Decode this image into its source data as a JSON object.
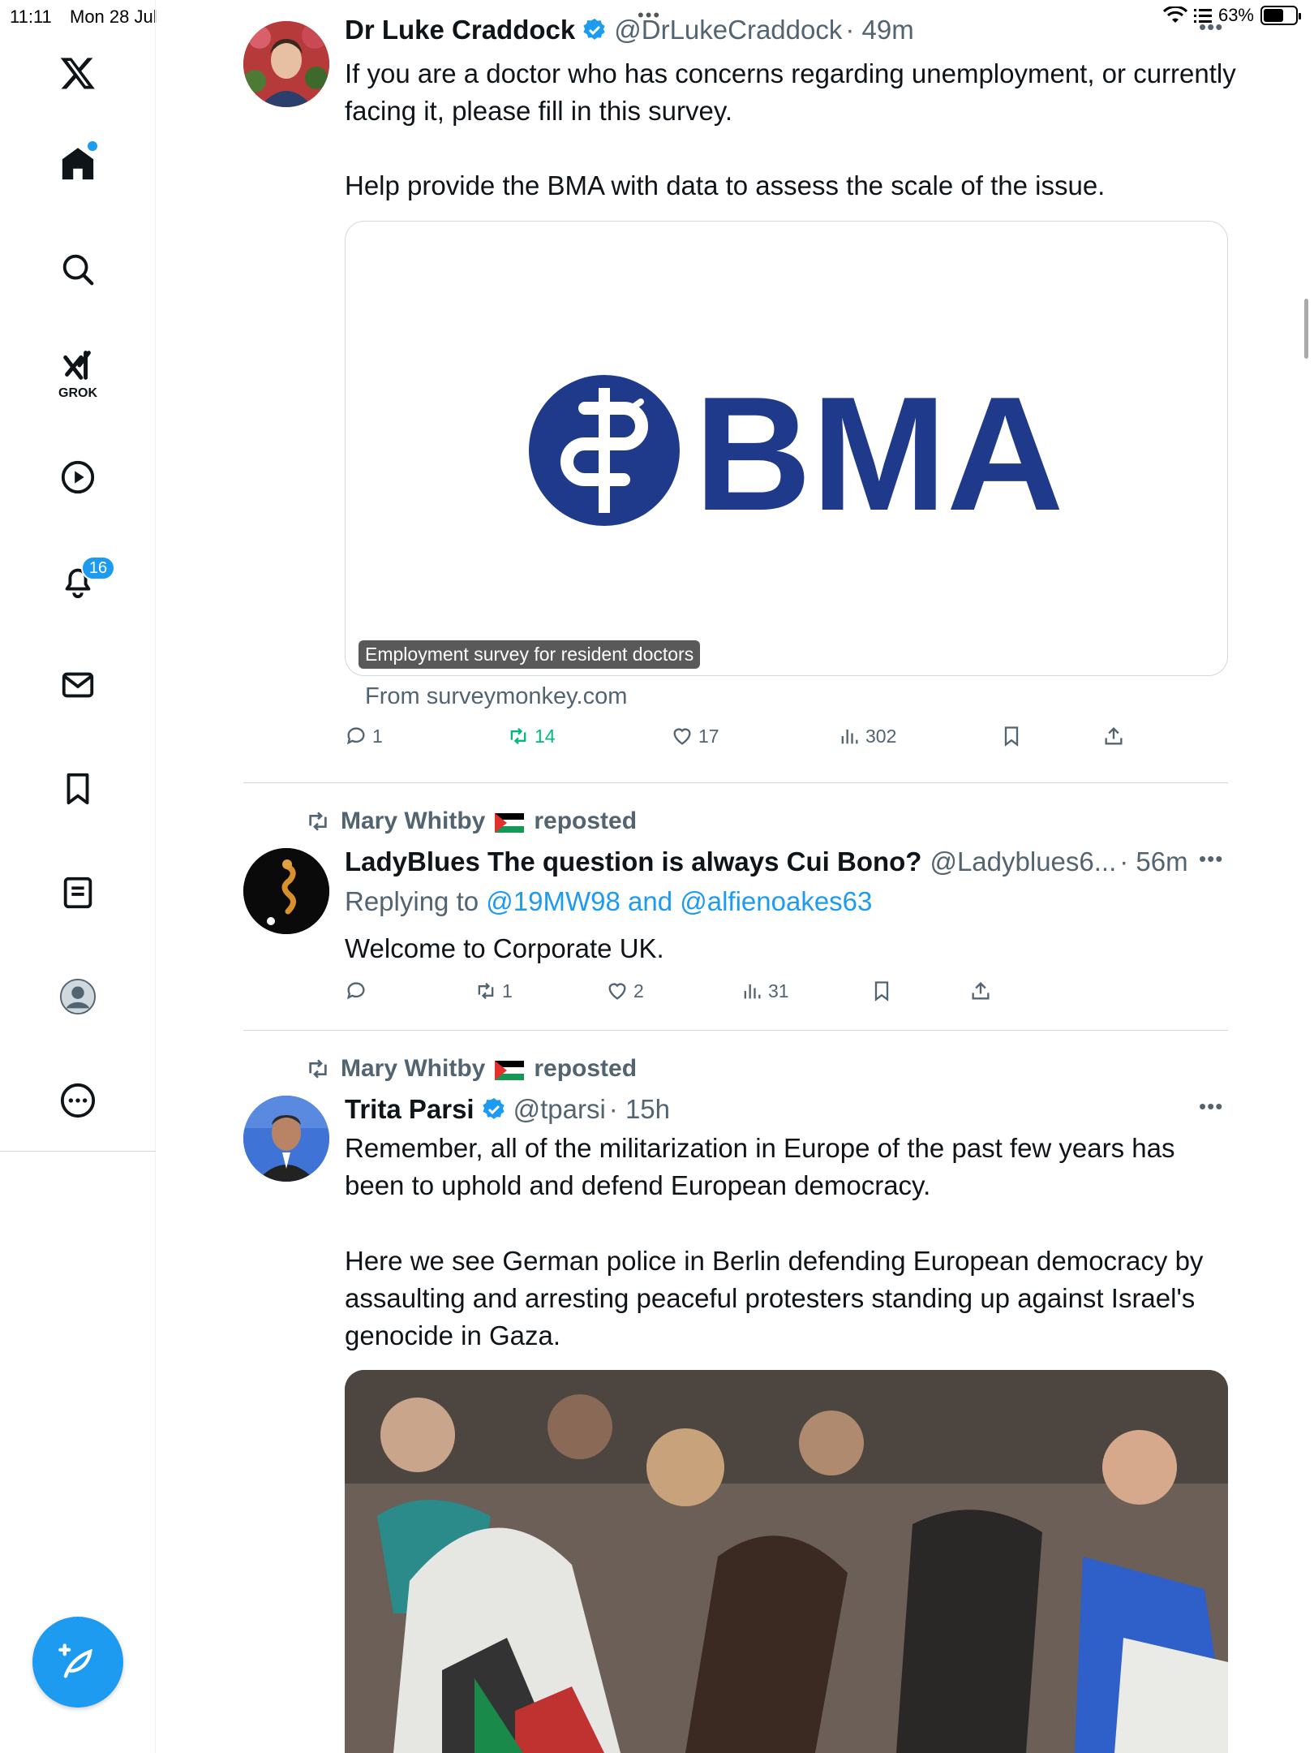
{
  "status_bar": {
    "time": "11:11",
    "date": "Mon 28 Jul",
    "battery": "63%",
    "battery_level": 0.63
  },
  "sidebar": {
    "items": [
      {
        "name": "x-logo"
      },
      {
        "name": "home"
      },
      {
        "name": "search"
      },
      {
        "name": "grok",
        "label": "GROK"
      },
      {
        "name": "video"
      },
      {
        "name": "notifications",
        "badge": "16"
      },
      {
        "name": "messages"
      },
      {
        "name": "bookmarks"
      },
      {
        "name": "lists"
      },
      {
        "name": "profile"
      },
      {
        "name": "more"
      }
    ]
  },
  "accent_color": "#1d9bf0",
  "repost_color": "#00ba7c",
  "posts": [
    {
      "author": "Dr Luke Craddock",
      "handle": "@DrLukeCraddock",
      "time": "· 49m",
      "verified": true,
      "text_1": "If you are a doctor who has concerns regarding unemployment, or currently facing it, please fill in this survey.",
      "text_2": "Help provide the BMA with data to assess the scale of the issue.",
      "card": {
        "logo_text": "BMA",
        "label": "Employment survey for resident doctors",
        "source": "From surveymonkey.com"
      },
      "stats": {
        "replies": "1",
        "reposts": "14",
        "likes": "17",
        "views": "302"
      }
    },
    {
      "reposted_by": "Mary Whitby",
      "reposted_label": "reposted",
      "author": "LadyBlues The question is always Cui Bono?",
      "handle": "@Ladyblues6...",
      "time": "· 56m",
      "reply_prefix": "Replying to",
      "reply_to": "@19MW98 and @alfienoakes63",
      "text_1": "Welcome to Corporate UK.",
      "stats": {
        "replies": "",
        "reposts": "1",
        "likes": "2",
        "views": "31"
      }
    },
    {
      "reposted_by": "Mary Whitby",
      "reposted_label": "reposted",
      "author": "Trita Parsi",
      "handle": "@tparsi",
      "time": "· 15h",
      "verified": true,
      "text_1": "Remember, all of the militarization in Europe of the past few years has been to uphold and defend European democracy.",
      "text_2": "Here we see German police in Berlin defending European democracy by assaulting and arresting peaceful protesters standing up against Israel's genocide in Gaza."
    }
  ]
}
